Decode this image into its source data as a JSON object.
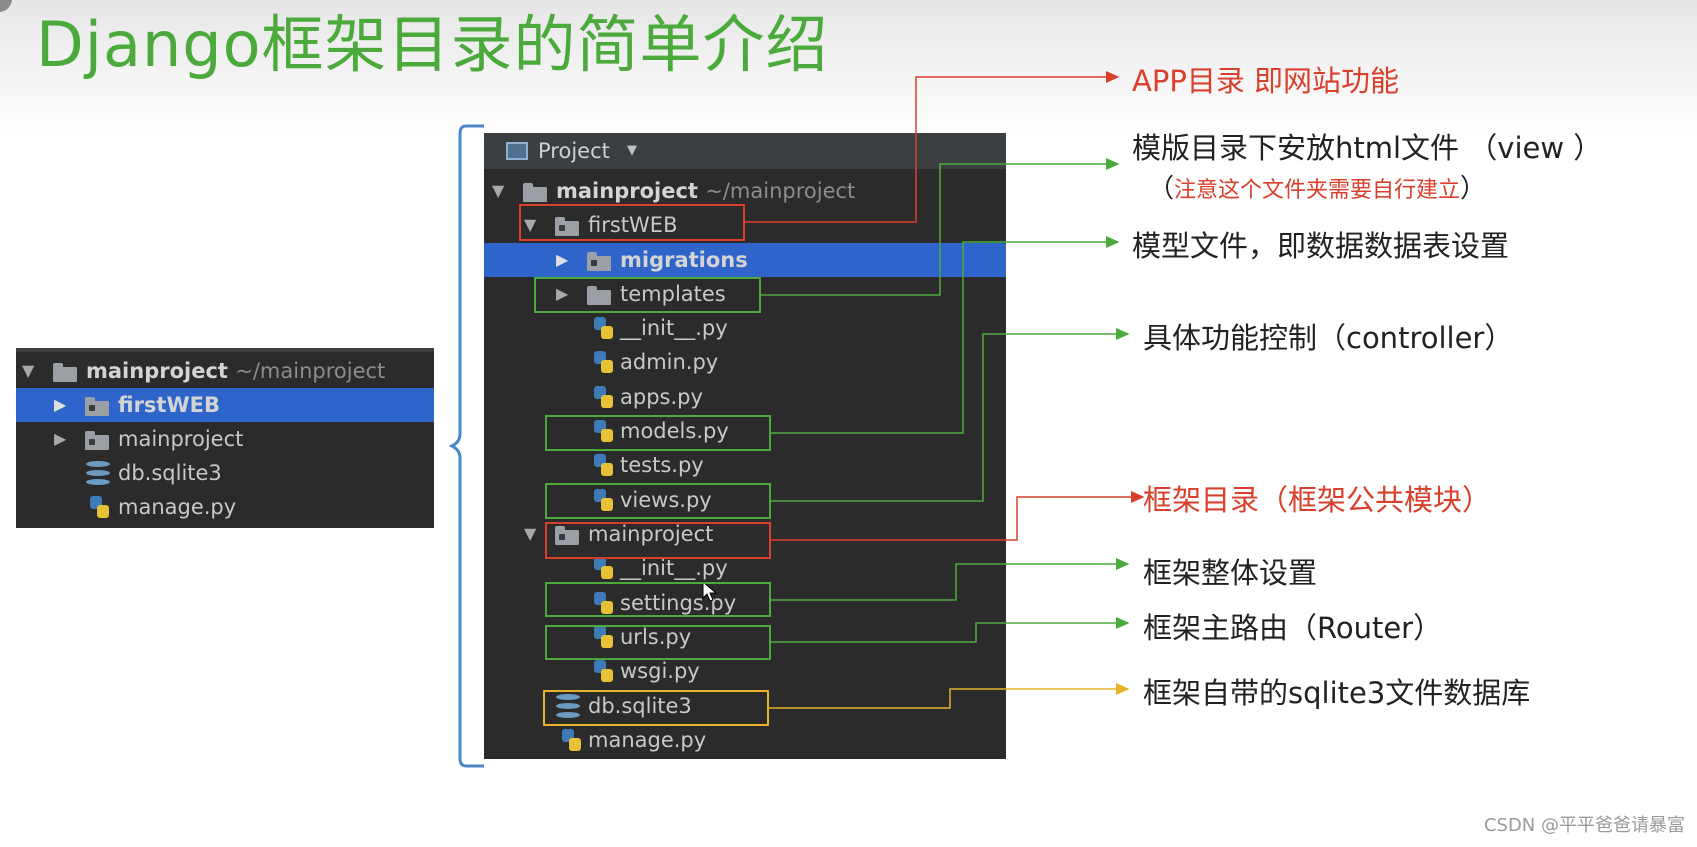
{
  "title": "Django框架目录的简单介绍",
  "small_tree": {
    "rows": [
      {
        "label": "mainproject",
        "hint": "~/mainproject"
      },
      {
        "label": "firstWEB"
      },
      {
        "label": "mainproject"
      },
      {
        "label": "db.sqlite3"
      },
      {
        "label": "manage.py"
      }
    ]
  },
  "panel": {
    "header": "Project",
    "rows": [
      {
        "label": "mainproject",
        "hint": "~/mainproject"
      },
      {
        "label": "firstWEB"
      },
      {
        "label": "migrations"
      },
      {
        "label": "templates"
      },
      {
        "label": "__init__.py"
      },
      {
        "label": "admin.py"
      },
      {
        "label": "apps.py"
      },
      {
        "label": "models.py"
      },
      {
        "label": "tests.py"
      },
      {
        "label": "views.py"
      },
      {
        "label": "mainproject"
      },
      {
        "label": "__init__.py"
      },
      {
        "label": "settings.py"
      },
      {
        "label": "urls.py"
      },
      {
        "label": "wsgi.py"
      },
      {
        "label": "db.sqlite3"
      },
      {
        "label": "manage.py"
      }
    ]
  },
  "annotations": {
    "app_dir": "APP目录 即网站功能",
    "templates": "模版目录下安放html文件 （view ）",
    "templates_note_open": "（",
    "templates_note": "注意这个文件夹需要自行建立",
    "templates_note_close": "）",
    "models": "模型文件，即数据数据表设置",
    "views": "具体功能控制（controller）",
    "framework_dir": "框架目录（框架公共模块）",
    "settings": "框架整体设置",
    "urls": "框架主路由（Router）",
    "sqlite": "框架自带的sqlite3文件数据库"
  },
  "colors": {
    "red": "#d9402b",
    "green": "#4caa3c",
    "yellow": "#e5b22a",
    "blue_bracket": "#4a86c8",
    "selection": "#2f65ca"
  },
  "watermark": "CSDN @平平爸爸请暴富"
}
